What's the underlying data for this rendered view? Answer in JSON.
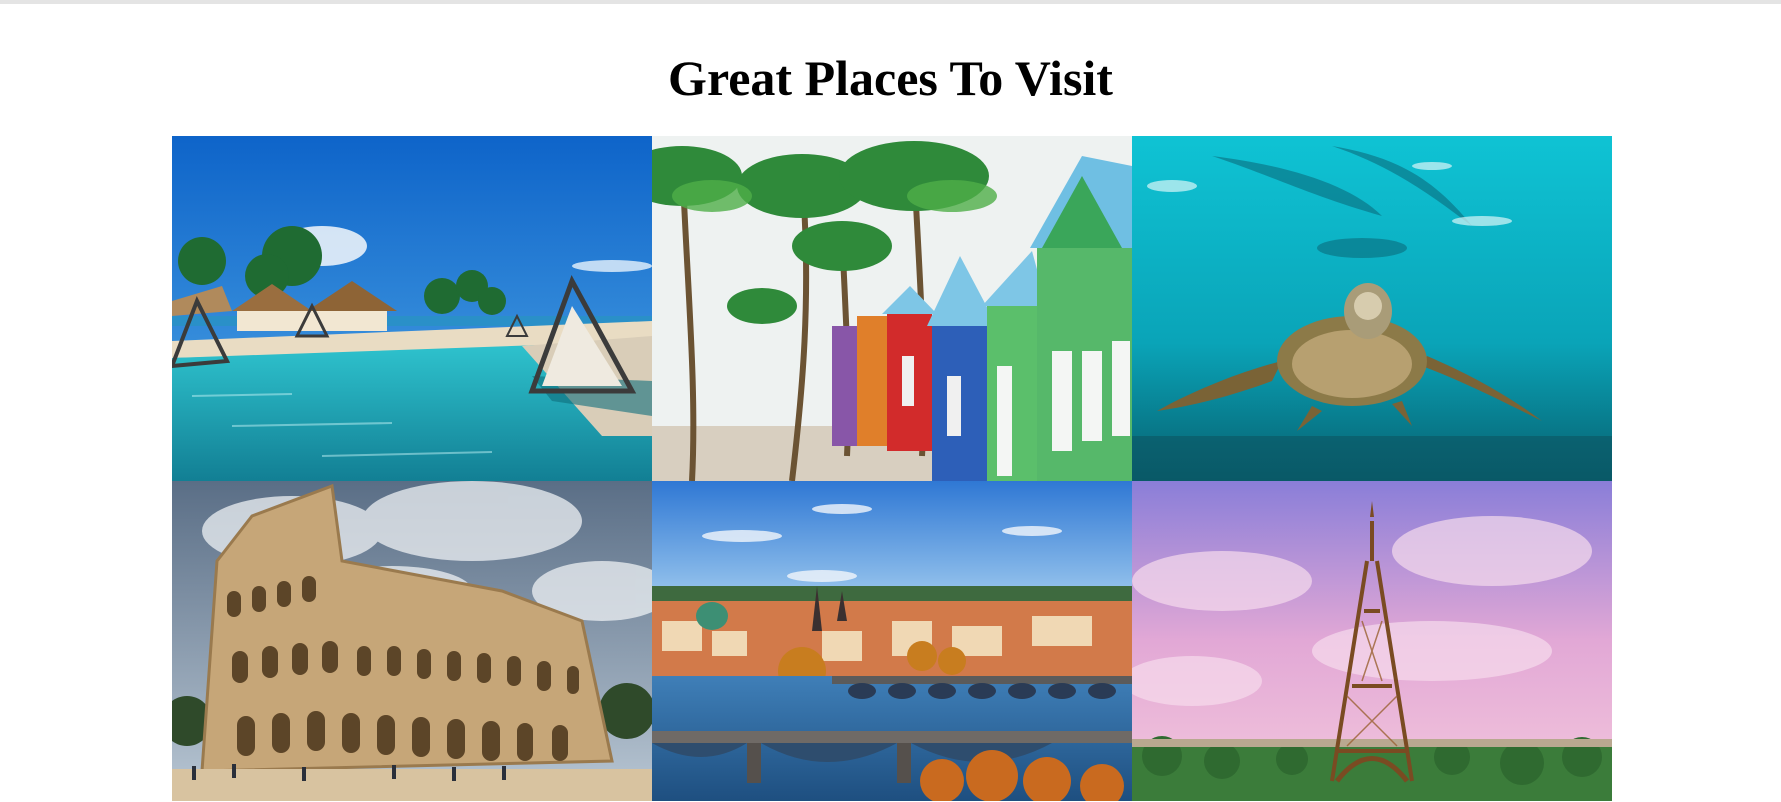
{
  "page": {
    "heading": "Great Places To Visit"
  },
  "gallery": {
    "items": [
      {
        "subject": "tropical resort infinity pool with pyramid cabanas",
        "icon": "resort-pool-image"
      },
      {
        "subject": "colorful beach huts under palm trees",
        "icon": "beach-huts-image"
      },
      {
        "subject": "sea turtle swimming in turquoise water",
        "icon": "sea-turtle-image"
      },
      {
        "subject": "Colosseum in Rome under cloudy sky",
        "icon": "colosseum-image"
      },
      {
        "subject": "Prague bridges over the river at sunset",
        "icon": "prague-bridges-image"
      },
      {
        "subject": "Eiffel Tower under pink sky",
        "icon": "eiffel-tower-image"
      }
    ]
  },
  "colors": {
    "heading": "#000000",
    "ocean": "#1a7fd6",
    "pool": "#1bb5c2",
    "turquoise": "#12b7c9",
    "pink_sky": "#d7a8d6"
  }
}
